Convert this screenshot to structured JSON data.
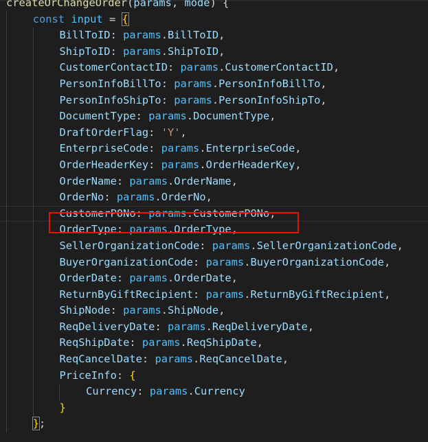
{
  "signature": {
    "function_name": "createOrChangeOrder",
    "open_paren": "(",
    "param1": "params",
    "comma": ", ",
    "param2": "mode",
    "close": ") {"
  },
  "declaration": {
    "keyword": "const",
    "name": "input",
    "equals": " = ",
    "brace": "{"
  },
  "fields": [
    {
      "key": "BillToID",
      "value": "BillToID"
    },
    {
      "key": "ShipToID",
      "value": "ShipToID"
    },
    {
      "key": "CustomerContactID",
      "value": "CustomerContactID"
    },
    {
      "key": "PersonInfoBillTo",
      "value": "PersonInfoBillTo"
    },
    {
      "key": "PersonInfoShipTo",
      "value": "PersonInfoShipTo"
    },
    {
      "key": "DocumentType",
      "value": "DocumentType"
    },
    {
      "key": "DraftOrderFlag",
      "string_value": "'Y'"
    },
    {
      "key": "EnterpriseCode",
      "value": "EnterpriseCode"
    },
    {
      "key": "OrderHeaderKey",
      "value": "OrderHeaderKey"
    },
    {
      "key": "OrderName",
      "value": "OrderName"
    },
    {
      "key": "OrderNo",
      "value": "OrderNo"
    },
    {
      "key": "CustomerPONo",
      "value": "CustomerPONo"
    },
    {
      "key": "OrderType",
      "value": "OrderType"
    },
    {
      "key": "SellerOrganizationCode",
      "value": "SellerOrganizationCode"
    },
    {
      "key": "BuyerOrganizationCode",
      "value": "BuyerOrganizationCode"
    },
    {
      "key": "OrderDate",
      "value": "OrderDate"
    },
    {
      "key": "ReturnByGiftRecipient",
      "value": "ReturnByGiftRecipient"
    },
    {
      "key": "ShipNode",
      "value": "ShipNode"
    },
    {
      "key": "ReqDeliveryDate",
      "value": "ReqDeliveryDate"
    },
    {
      "key": "ReqShipDate",
      "value": "ReqShipDate"
    },
    {
      "key": "ReqCancelDate",
      "value": "ReqCancelDate"
    }
  ],
  "object_prefix": "params",
  "dot": ".",
  "colon": ": ",
  "trailing_comma": ",",
  "price_info": {
    "key": "PriceInfo",
    "open": "{",
    "inner_key": "Currency",
    "inner_value": "Currency",
    "close": "}"
  },
  "closing": {
    "brace": "}",
    "semicolon": ";"
  },
  "highlighted_field": "CustomerPONo",
  "colors": {
    "background": "#1e1e1e",
    "function": "#dcdcaa",
    "keyword": "#569cd6",
    "variable": "#4fc1ff",
    "property": "#9cdcfe",
    "string": "#ce9178",
    "highlight_box": "#e51400"
  }
}
